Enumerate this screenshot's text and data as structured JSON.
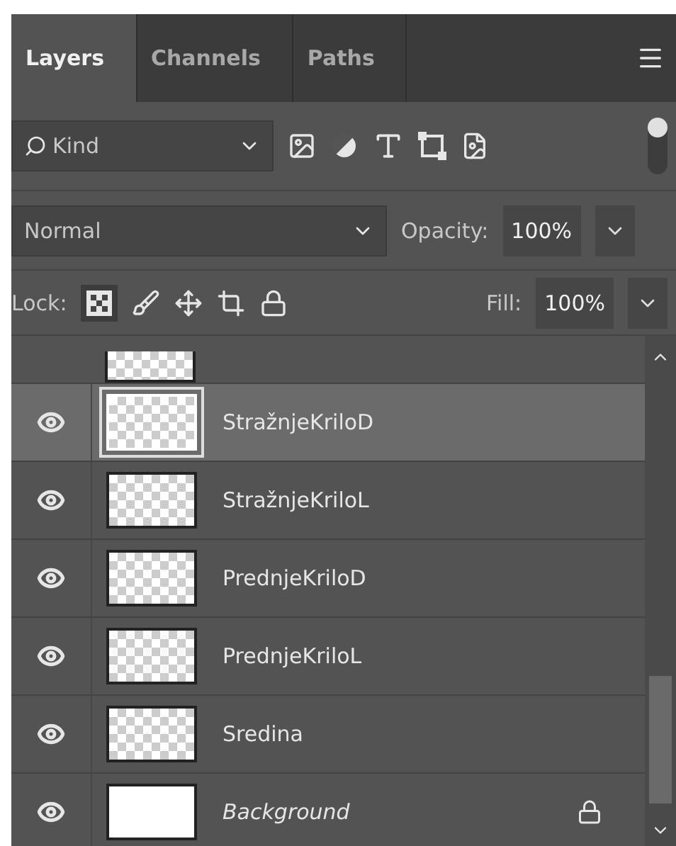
{
  "tabs": [
    {
      "label": "Layers",
      "selected": true
    },
    {
      "label": "Channels",
      "selected": false
    },
    {
      "label": "Paths",
      "selected": false
    }
  ],
  "filter": {
    "value": "Kind",
    "on": true
  },
  "blend": {
    "mode": "Normal",
    "opacity_label": "Opacity:",
    "opacity": "100%"
  },
  "lock": {
    "label": "Lock:",
    "transparent_locked": true,
    "fill_label": "Fill:",
    "fill": "100%"
  },
  "layers": [
    {
      "name": "StražnjeKriloD",
      "kind": "transparent",
      "selected": true,
      "visible": true,
      "locked": false,
      "italic": false
    },
    {
      "name": "StražnjeKriloL",
      "kind": "transparent",
      "selected": false,
      "visible": true,
      "locked": false,
      "italic": false
    },
    {
      "name": "PrednjeKriloD",
      "kind": "transparent",
      "selected": false,
      "visible": true,
      "locked": false,
      "italic": false
    },
    {
      "name": "PrednjeKriloL",
      "kind": "transparent",
      "selected": false,
      "visible": true,
      "locked": false,
      "italic": false
    },
    {
      "name": "Sredina",
      "kind": "transparent",
      "selected": false,
      "visible": true,
      "locked": false,
      "italic": false
    },
    {
      "name": "Background",
      "kind": "white",
      "selected": false,
      "visible": true,
      "locked": true,
      "italic": true
    }
  ]
}
